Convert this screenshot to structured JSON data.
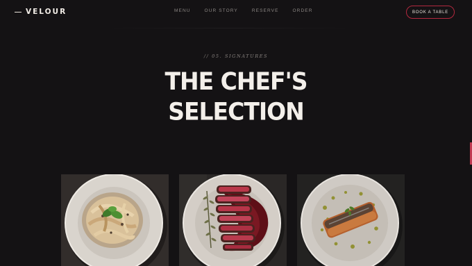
{
  "nav": {
    "logo": "VELOUR",
    "links": [
      "MENU",
      "OUR STORY",
      "RESERVE",
      "ORDER"
    ],
    "cta": "BOOK A TABLE"
  },
  "hero": {
    "eyebrow": "// 05. SIGNATURES",
    "title_line1": "THE CHEF'S",
    "title_line2": "SELECTION"
  },
  "colors": {
    "background": "#141214",
    "accent": "#b4283f",
    "text": "#f3efea"
  },
  "dishes": [
    {
      "image": "truffle-pasta-with-basil"
    },
    {
      "image": "sliced-steak-with-red-wine-jus-and-thyme"
    },
    {
      "image": "seared-salmon-with-herb-oil"
    }
  ]
}
